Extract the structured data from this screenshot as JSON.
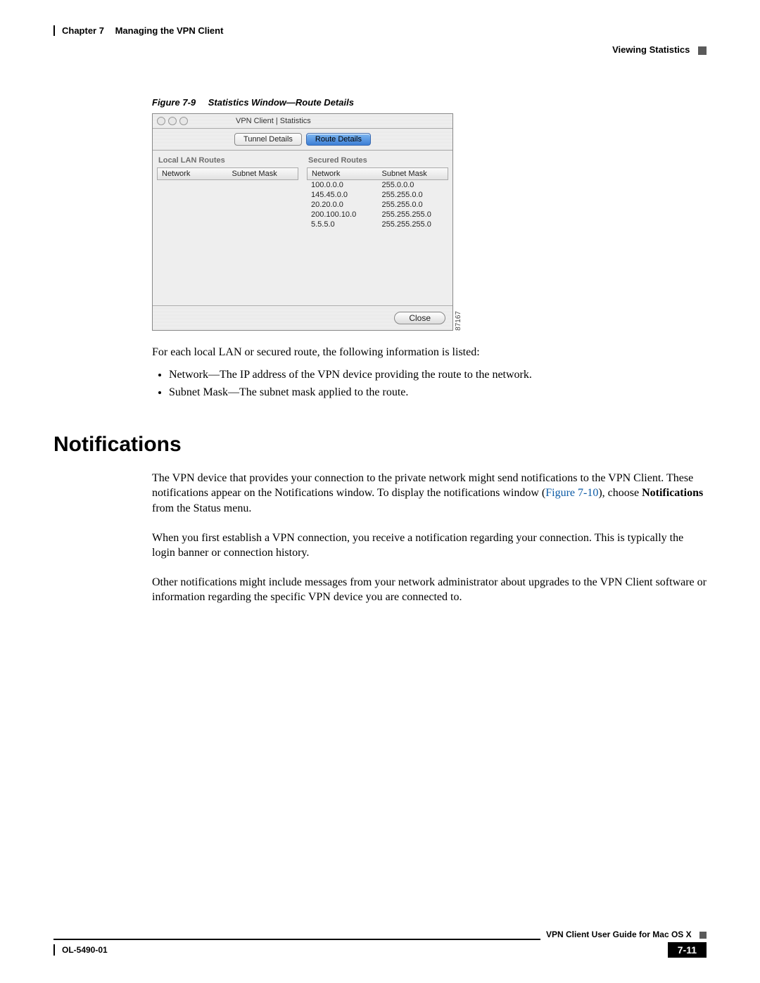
{
  "header": {
    "chapter_num": "Chapter 7",
    "chapter_title": "Managing the VPN Client",
    "section": "Viewing Statistics"
  },
  "figure": {
    "num": "Figure 7-9",
    "title": "Statistics Window—Route Details",
    "image_id": "87167"
  },
  "screenshot": {
    "window_title": "VPN Client  |  Statistics",
    "tabs": {
      "tunnel": "Tunnel Details",
      "route": "Route Details"
    },
    "local_title": "Local LAN Routes",
    "secured_title": "Secured Routes",
    "col_network": "Network",
    "col_mask": "Subnet Mask",
    "secured_rows": [
      {
        "network": "100.0.0.0",
        "mask": "255.0.0.0"
      },
      {
        "network": "145.45.0.0",
        "mask": "255.255.0.0"
      },
      {
        "network": "20.20.0.0",
        "mask": "255.255.0.0"
      },
      {
        "network": "200.100.10.0",
        "mask": "255.255.255.0"
      },
      {
        "network": "5.5.5.0",
        "mask": "255.255.255.0"
      }
    ],
    "close": "Close"
  },
  "para1": "For each local LAN or secured route, the following information is listed:",
  "bullet1": "Network—The IP address of the VPN device providing the route to the network.",
  "bullet2": "Subnet Mask—The subnet mask applied to the route.",
  "heading": "Notifications",
  "para2_a": "The VPN device that provides your connection to the private network might send notifications to the VPN Client. These notifications appear on the Notifications window. To display the notifications window (",
  "para2_link": "Figure 7-10",
  "para2_b": "), choose ",
  "para2_bold": "Notifications",
  "para2_c": " from the Status menu.",
  "para3": "When you first establish a VPN connection, you receive a notification regarding your connection. This is typically the login banner or connection history.",
  "para4": "Other notifications might include messages from your network administrator about upgrades to the VPN Client software or information regarding the specific VPN device you are connected to.",
  "footer": {
    "guide": "VPN Client User Guide for Mac OS X",
    "docnum": "OL-5490-01",
    "pagenum": "7-11"
  }
}
